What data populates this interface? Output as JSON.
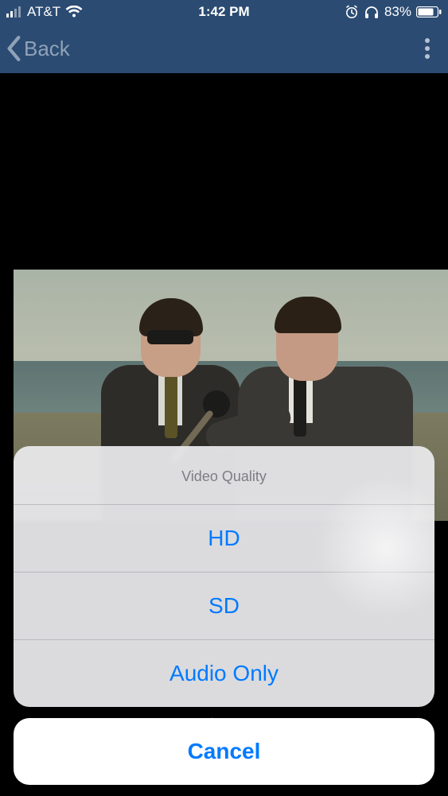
{
  "statusbar": {
    "carrier": "AT&T",
    "time": "1:42 PM",
    "battery_pct": "83%"
  },
  "navbar": {
    "back_label": "Back"
  },
  "playback": {
    "controls": [
      "rewind",
      "play",
      "forward"
    ]
  },
  "action_sheet": {
    "title": "Video Quality",
    "options": [
      {
        "label": "HD"
      },
      {
        "label": "SD"
      },
      {
        "label": "Audio Only"
      }
    ],
    "cancel_label": "Cancel"
  }
}
